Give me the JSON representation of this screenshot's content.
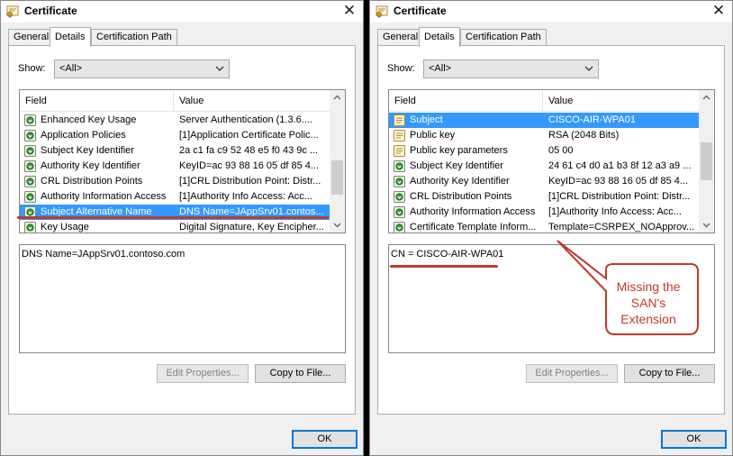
{
  "colors": {
    "selection": "#3399ff",
    "annotation_red": "#c0392b",
    "dialog_bg": "#f0f0f0",
    "ok_border": "#0078d7"
  },
  "left": {
    "title": "Certificate",
    "tabs": [
      "General",
      "Details",
      "Certification Path"
    ],
    "active_tab": "Details",
    "show_label": "Show:",
    "show_value": "<All>",
    "columns": {
      "field": "Field",
      "value": "Value"
    },
    "rows": [
      {
        "icon": "extension-icon",
        "field": "Enhanced Key Usage",
        "value": "Server Authentication (1.3.6...."
      },
      {
        "icon": "extension-icon",
        "field": "Application Policies",
        "value": "[1]Application Certificate Polic..."
      },
      {
        "icon": "extension-icon",
        "field": "Subject Key Identifier",
        "value": "2a c1 fa c9 52 48 e5 f0 43 9c ..."
      },
      {
        "icon": "extension-icon",
        "field": "Authority Key Identifier",
        "value": "KeyID=ac 93 88 16 05 df 85 4..."
      },
      {
        "icon": "extension-icon",
        "field": "CRL Distribution Points",
        "value": "[1]CRL Distribution Point: Distr..."
      },
      {
        "icon": "extension-icon",
        "field": "Authority Information Access",
        "value": "[1]Authority Info Access: Acc..."
      },
      {
        "icon": "extension-icon",
        "field": "Subject Alternative Name",
        "value": "DNS Name=JAppSrv01.contos...",
        "selected": true
      },
      {
        "icon": "extension-icon",
        "field": "Key Usage",
        "value": "Digital Signature, Key Encipher..."
      }
    ],
    "detail_value": "DNS Name=JAppSrv01.contoso.com",
    "edit_button": "Edit Properties...",
    "copy_button": "Copy to File...",
    "ok_button": "OK"
  },
  "right": {
    "title": "Certificate",
    "tabs": [
      "General",
      "Details",
      "Certification Path"
    ],
    "active_tab": "Details",
    "show_label": "Show:",
    "show_value": "<All>",
    "columns": {
      "field": "Field",
      "value": "Value"
    },
    "rows": [
      {
        "icon": "field-icon",
        "field": "Subject",
        "value": "CISCO-AIR-WPA01",
        "selected": true
      },
      {
        "icon": "field-icon",
        "field": "Public key",
        "value": "RSA (2048 Bits)"
      },
      {
        "icon": "field-icon",
        "field": "Public key parameters",
        "value": "05 00"
      },
      {
        "icon": "extension-icon",
        "field": "Subject Key Identifier",
        "value": "24 61 c4 d0 a1 b3 8f 12 a3 a9 ..."
      },
      {
        "icon": "extension-icon",
        "field": "Authority Key Identifier",
        "value": "KeyID=ac 93 88 16 05 df 85 4..."
      },
      {
        "icon": "extension-icon",
        "field": "CRL Distribution Points",
        "value": "[1]CRL Distribution Point: Distr..."
      },
      {
        "icon": "extension-icon",
        "field": "Authority Information Access",
        "value": "[1]Authority Info Access: Acc..."
      },
      {
        "icon": "extension-icon",
        "field": "Certificate Template Inform...",
        "value": "Template=CSRPEX_NOApprov..."
      }
    ],
    "detail_value": "CN = CISCO-AIR-WPA01",
    "edit_button": "Edit Properties...",
    "copy_button": "Copy to File...",
    "ok_button": "OK",
    "callout": [
      "Missing the",
      "SAN's",
      "Extension"
    ]
  }
}
